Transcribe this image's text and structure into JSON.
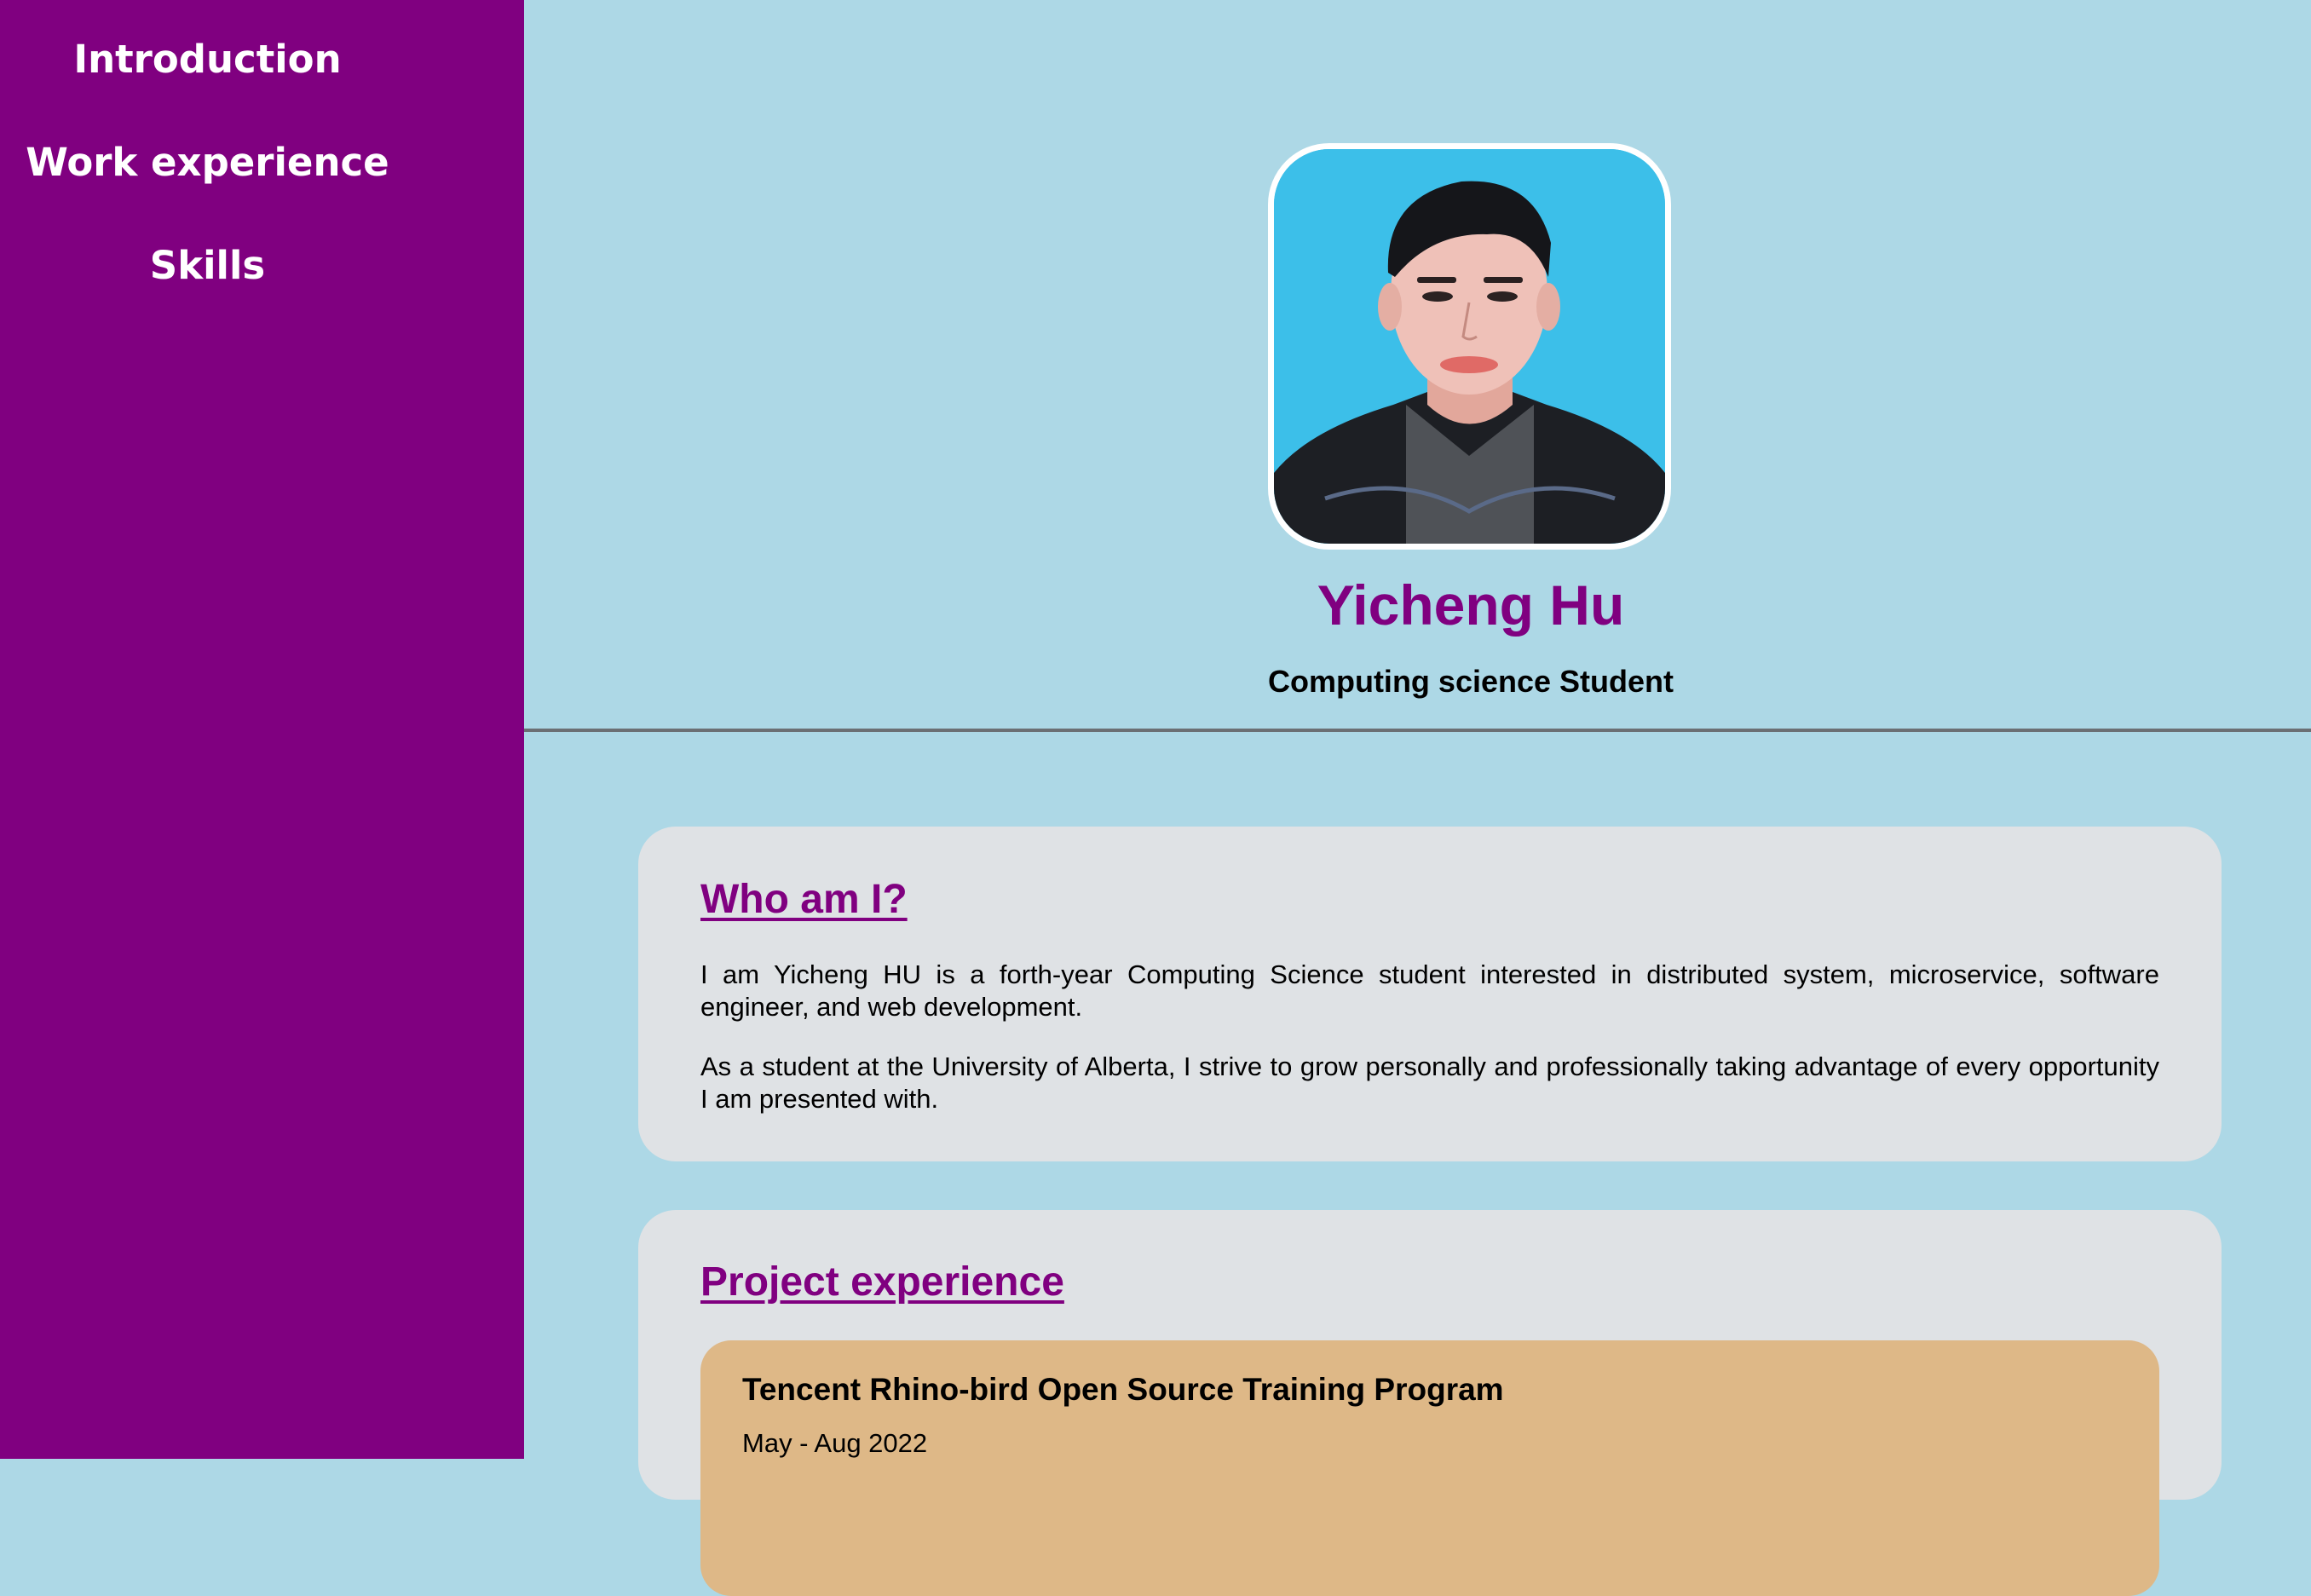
{
  "nav": {
    "items": [
      {
        "label": "Introduction"
      },
      {
        "label": "Work experience"
      },
      {
        "label": "Skills"
      }
    ]
  },
  "header": {
    "name": "Yicheng Hu",
    "role": "Computing science Student"
  },
  "about": {
    "title": "Who am I?",
    "paragraphs": [
      "I am Yicheng HU is a forth-year Computing Science student interested in distributed system, microservice, software engineer, and web development.",
      "As a student at the University of Alberta, I strive to grow personally and professionally taking advantage of every opportunity I am presented with."
    ]
  },
  "projects": {
    "title": "Project experience",
    "items": [
      {
        "title": "Tencent Rhino-bird Open Source Training Program",
        "date": "May - Aug 2022"
      }
    ]
  }
}
